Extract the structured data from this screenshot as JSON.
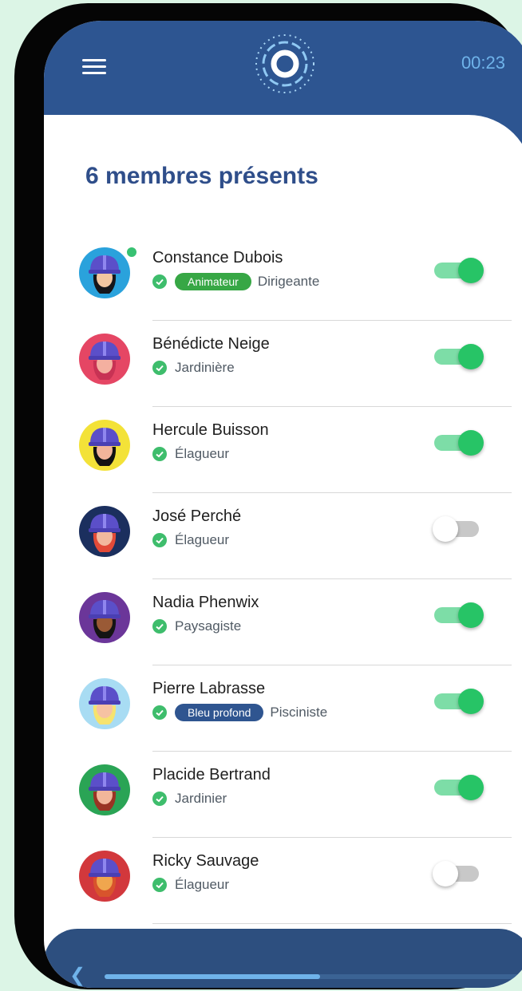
{
  "header": {
    "timer": "00:23"
  },
  "page": {
    "title": "6 membres présents"
  },
  "members": [
    {
      "name": "Constance Dubois",
      "badge": "Animateur",
      "badge_color": "#37a745",
      "role": "Dirigeante",
      "present": true,
      "online": true,
      "avatar_bg": "#2aa2dc",
      "skin": "#f2c6a0",
      "hair": "#16161a"
    },
    {
      "name": "Bénédicte Neige",
      "role": "Jardinière",
      "present": true,
      "avatar_bg": "#e54664",
      "skin": "#f4b0a0",
      "hair": "#c83254"
    },
    {
      "name": "Hercule Buisson",
      "role": "Élagueur",
      "present": true,
      "avatar_bg": "#f3e238",
      "skin": "#f2b49a",
      "hair": "#121212"
    },
    {
      "name": "José Perché",
      "role": "Élagueur",
      "present": false,
      "avatar_bg": "#1b2f5e",
      "skin": "#f2b89e",
      "hair": "#e24a38"
    },
    {
      "name": "Nadia Phenwix",
      "role": "Paysagiste",
      "present": true,
      "avatar_bg": "#6b3699",
      "skin": "#9a5a36",
      "hair": "#141414"
    },
    {
      "name": "Pierre Labrasse",
      "badge": "Bleu profond",
      "badge_color": "#2f5590",
      "role": "Pisciniste",
      "present": true,
      "avatar_bg": "#a8dcf3",
      "skin": "#f6c2a2",
      "hair": "#f6e36e"
    },
    {
      "name": "Placide Bertrand",
      "role": "Jardinier",
      "present": true,
      "avatar_bg": "#2aa455",
      "skin": "#f2b69a",
      "hair": "#9a3424"
    },
    {
      "name": "Ricky Sauvage",
      "role": "Élagueur",
      "present": false,
      "avatar_bg": "#d2383c",
      "skin": "#f0a64e",
      "hair": "#d8542c"
    }
  ],
  "footer": {
    "back_icon": "chevron-left-icon",
    "progress": 0.52
  },
  "colors": {
    "header_bg": "#2d5591",
    "title": "#2f4e8a",
    "toggle_on": "#27c466",
    "toggle_track_on": "#7ddda7",
    "background": "#dcf5e6"
  }
}
